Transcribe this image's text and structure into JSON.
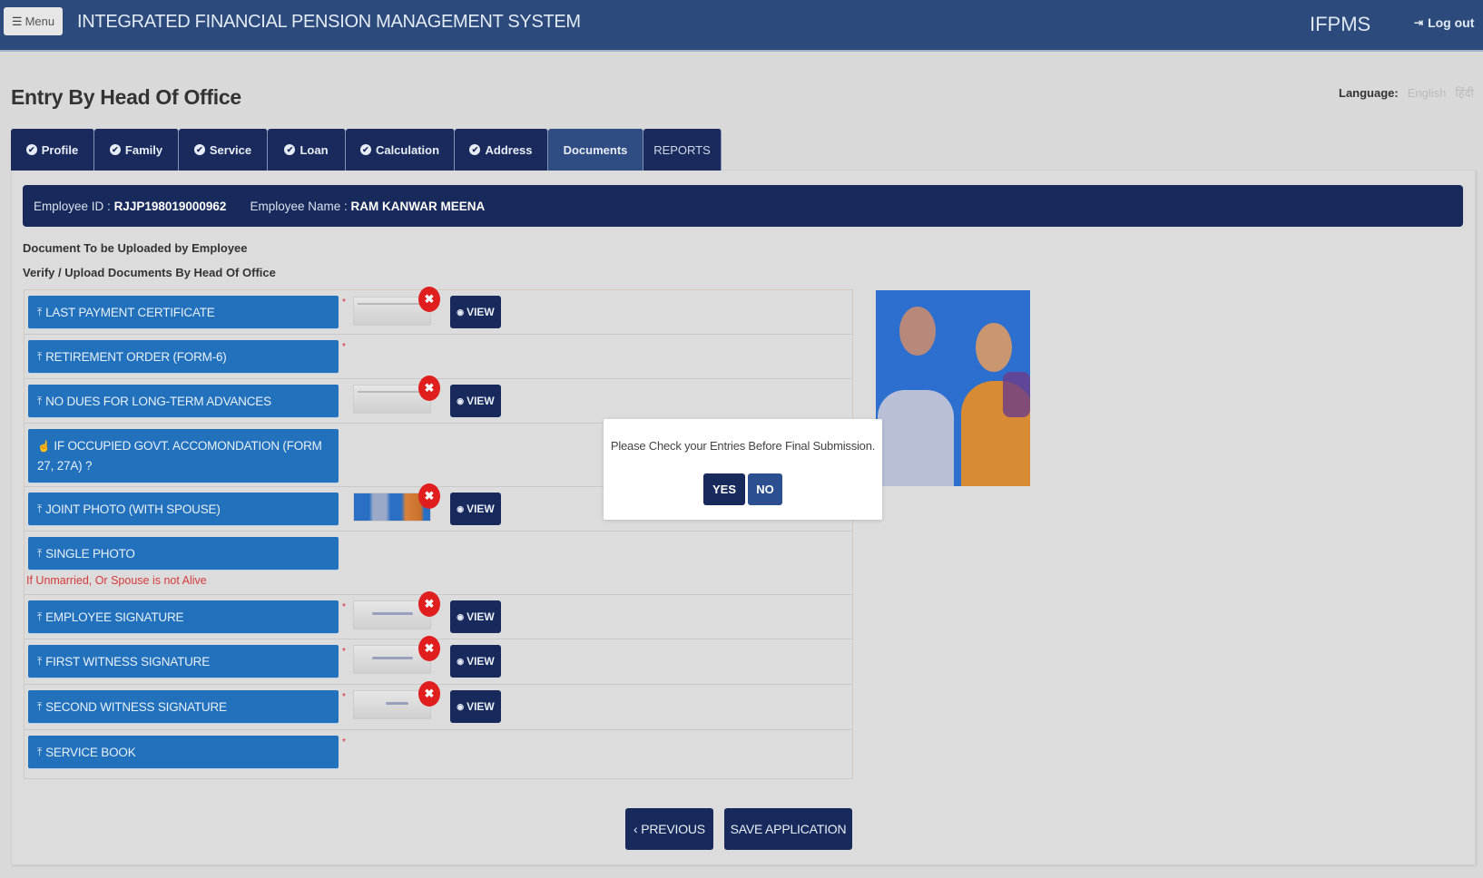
{
  "header": {
    "menu_label": "Menu",
    "menu_icon": "hamburger-icon",
    "app_title": "INTEGRATED FINANCIAL PENSION MANAGEMENT SYSTEM",
    "brand": "IFPMS",
    "logout_label": "Log out",
    "logout_icon": "sign-out-icon"
  },
  "page": {
    "title": "Entry By Head Of Office",
    "language_label": "Language:",
    "language_options": [
      "English",
      "हिंदी"
    ]
  },
  "tabs": [
    {
      "label": "Profile",
      "completed": true
    },
    {
      "label": "Family",
      "completed": true
    },
    {
      "label": "Service",
      "completed": true
    },
    {
      "label": "Loan",
      "completed": true
    },
    {
      "label": "Calculation",
      "completed": true
    },
    {
      "label": "Address",
      "completed": true
    },
    {
      "label": "Documents",
      "completed": false,
      "active": true
    },
    {
      "label": "REPORTS",
      "completed": false
    }
  ],
  "employee": {
    "id_label": "Employee ID :",
    "id_value": "RJJP198019000962",
    "name_label": "Employee Name :",
    "name_value": "RAM KANWAR MEENA"
  },
  "documents_section": {
    "subtitle_1": "Document To be Uploaded by Employee",
    "subtitle_2": "Verify / Upload Documents By Head Of Office",
    "view_label": "VIEW",
    "delete_glyph": "✖",
    "items": [
      {
        "label": "LAST PAYMENT CERTIFICATE",
        "required": true,
        "uploaded": true,
        "icon": "upload-icon"
      },
      {
        "label": "RETIREMENT ORDER (FORM-6)",
        "required": true,
        "uploaded": false,
        "icon": "upload-icon"
      },
      {
        "label": "NO DUES FOR LONG-TERM ADVANCES",
        "required": false,
        "uploaded": true,
        "icon": "upload-icon"
      },
      {
        "label": "IF OCCUPIED GOVT. ACCOMONDATION (FORM 27, 27A) ?",
        "required": false,
        "uploaded": false,
        "icon": "thumbs-up-icon"
      },
      {
        "label": "JOINT PHOTO (WITH SPOUSE)",
        "required": false,
        "uploaded": true,
        "icon": "upload-icon"
      },
      {
        "label": "SINGLE PHOTO",
        "required": false,
        "uploaded": false,
        "icon": "upload-icon",
        "note": "If Unmarried, Or Spouse is not Alive"
      },
      {
        "label": "EMPLOYEE SIGNATURE",
        "required": true,
        "uploaded": true,
        "icon": "upload-icon"
      },
      {
        "label": "FIRST WITNESS SIGNATURE",
        "required": true,
        "uploaded": true,
        "icon": "upload-icon"
      },
      {
        "label": "SECOND WITNESS SIGNATURE",
        "required": true,
        "uploaded": true,
        "icon": "upload-icon"
      },
      {
        "label": "SERVICE BOOK",
        "required": true,
        "uploaded": false,
        "icon": "upload-icon"
      }
    ]
  },
  "modal": {
    "message": "Please Check your Entries Before Final Submission.",
    "yes_label": "YES",
    "no_label": "NO"
  },
  "footer_buttons": {
    "previous_label": "‹ PREVIOUS",
    "save_label": "SAVE APPLICATION"
  },
  "colors": {
    "header_bg": "#2c4a7c",
    "navy": "#182a5c",
    "upload_blue": "#2271bc",
    "delete_red": "#e01e1e",
    "note_red": "#d6393a"
  }
}
